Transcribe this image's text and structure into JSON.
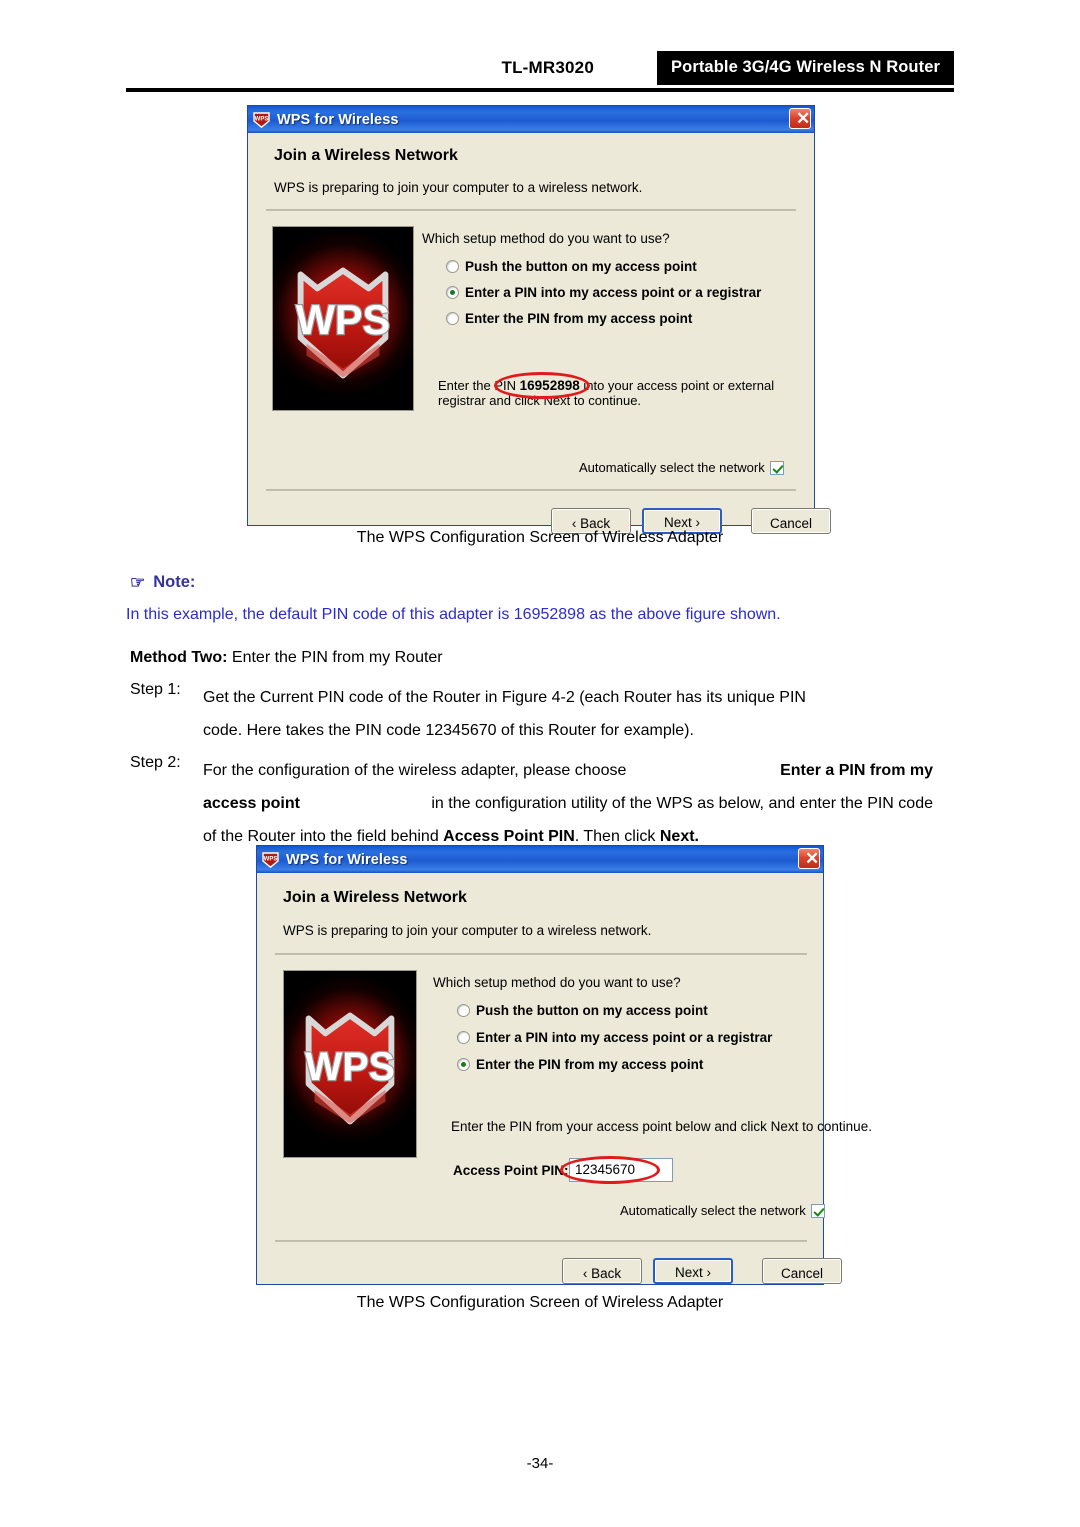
{
  "header": {
    "model": "TL-MR3020",
    "product": "Portable 3G/4G Wireless N Router"
  },
  "dialog1": {
    "title": "WPS for Wireless",
    "close_label": "✕",
    "heading": "Join a Wireless Network",
    "subtitle": "WPS is preparing to join your computer to a wireless network.",
    "logo_text": "WPS",
    "question": "Which setup method do you want to use?",
    "options": [
      {
        "label": "Push the button on my access point",
        "selected": false
      },
      {
        "label": "Enter a PIN into my access point or a registrar",
        "selected": true
      },
      {
        "label": "Enter the PIN from my access point",
        "selected": false
      }
    ],
    "pin_prefix": "Enter the PIN ",
    "pin_value": "16952898",
    "pin_suffix": " into your access point or external registrar and click Next to continue.",
    "autoselect_label": "Automatically select the network",
    "autoselect_checked": true,
    "buttons": {
      "back": "‹ Back",
      "next": "Next ›",
      "cancel": "Cancel"
    }
  },
  "caption1": "The WPS Configuration Screen of Wireless Adapter",
  "note": {
    "icon": "☞",
    "title": "Note:",
    "text": "In this example, the default PIN code of this adapter is 16952898 as the above figure shown."
  },
  "method_two": {
    "label": "Method Two:",
    "text": " Enter the PIN from my Router"
  },
  "step1": {
    "label": "Step 1:",
    "line1": "Get the Current PIN code of the Router in Figure 4-2 (each Router has its unique PIN",
    "line2": "code. Here takes the PIN code 12345670 of this Router for example)."
  },
  "step2": {
    "label": "Step 2:",
    "line1_a": "For the configuration of the wireless adapter, please choose ",
    "line1_b": "Enter a PIN from my",
    "line2_a": "access point",
    "line2_b": " in the configuration utility of the WPS as below, and enter the PIN code",
    "line3_a": "of the Router into the field behind ",
    "line3_b": "Access Point PIN",
    "line3_c": ". Then click ",
    "line3_d": "Next."
  },
  "dialog2": {
    "title": "WPS for Wireless",
    "close_label": "✕",
    "heading": "Join a Wireless Network",
    "subtitle": "WPS is preparing to join your computer to a wireless network.",
    "logo_text": "WPS",
    "question": "Which setup method do you want to use?",
    "options": [
      {
        "label": "Push the button on my access point",
        "selected": false
      },
      {
        "label": "Enter a PIN into my access point or a registrar",
        "selected": false
      },
      {
        "label": "Enter the PIN from my access point",
        "selected": true
      }
    ],
    "instruction": "Enter the PIN from your access point below and click Next to continue.",
    "ap_pin_label": "Access Point PIN:",
    "ap_pin_value": "12345670",
    "autoselect_label": "Automatically select the network",
    "autoselect_checked": true,
    "buttons": {
      "back": "‹ Back",
      "next": "Next ›",
      "cancel": "Cancel"
    }
  },
  "caption2": "The WPS Configuration Screen of Wireless Adapter",
  "page_number": "-34-",
  "colors": {
    "titlebar_blue": "#1d5bd0",
    "dialog_face": "#ece9d8",
    "note_blue": "#2b2bd0",
    "note_heading": "#33339b",
    "annotation_red": "#e01b1b",
    "header_black": "#000000"
  }
}
